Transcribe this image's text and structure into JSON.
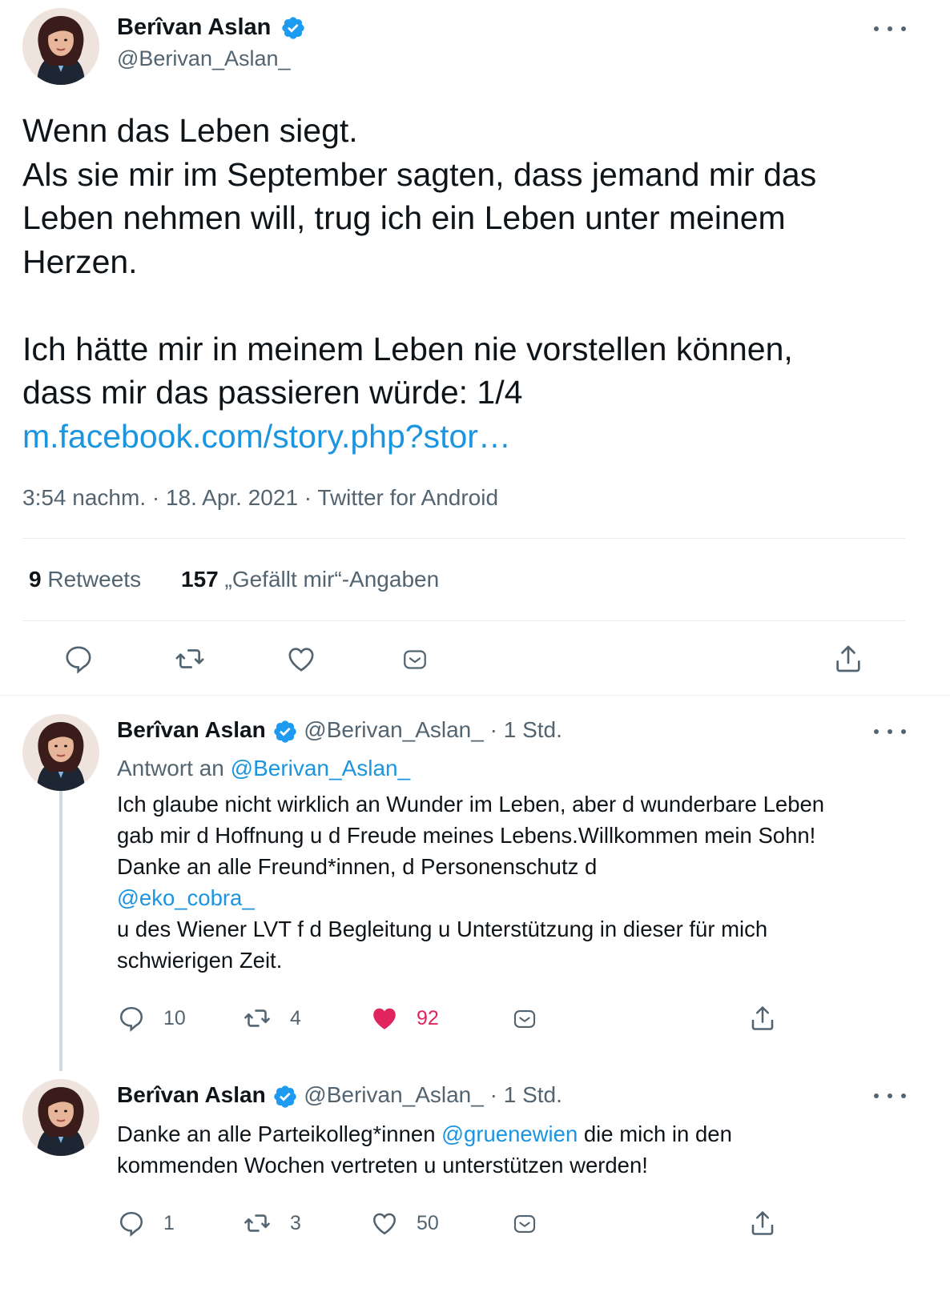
{
  "main_tweet": {
    "author_name": "Berîvan Aslan",
    "author_handle": "@Berivan_Aslan_",
    "text_lines": [
      "Wenn das Leben siegt.",
      "Als sie mir im September sagten, dass jemand mir das",
      "Leben nehmen will, trug ich ein Leben unter meinem",
      "Herzen.",
      "",
      "Ich hätte mir in meinem Leben nie vorstellen können,",
      "dass mir das passieren würde: 1/4"
    ],
    "link": "m.facebook.com/story.php?stor…",
    "meta": "3:54 nachm. · 18. Apr. 2021 · Twitter for Android",
    "retweets_count": "9",
    "retweets_label": "Retweets",
    "likes_count": "157",
    "likes_label": "„Gefällt mir“-Angaben"
  },
  "replies": [
    {
      "author_name": "Berîvan Aslan",
      "author_handle": "@Berivan_Aslan_",
      "time": "· 1 Std.",
      "reply_to_label": "Antwort an",
      "reply_to_handle": "@Berivan_Aslan_",
      "text_lines": [
        "Ich glaube nicht wirklich an Wunder im Leben, aber d wunderbare Leben",
        "gab mir d Hoffnung u d Freude meines Lebens.Willkommen mein Sohn!",
        "Danke an alle Freund*innen, d Personenschutz d"
      ],
      "mention": "@eko_cobra_",
      "text_after_lines": [
        "u des Wiener LVT f d Begleitung u Unterstützung in dieser für mich",
        "schwierigen Zeit."
      ],
      "reply_count": "10",
      "retweet_count": "4",
      "like_count": "92",
      "liked": true
    },
    {
      "author_name": "Berîvan Aslan",
      "author_handle": "@Berivan_Aslan_",
      "time": "· 1 Std.",
      "text_before": "Danke an alle Parteikolleg*innen ",
      "mention": "@gruenewien",
      "text_after": " die mich in den",
      "text_line2": "kommenden Wochen vertreten u unterstützen werden!",
      "reply_count": "1",
      "retweet_count": "3",
      "like_count": "50",
      "liked": false
    }
  ],
  "colors": {
    "link": "#1b95e0",
    "verified": "#1d9bf0",
    "liked": "#e0245e",
    "secondary_text": "#536471"
  },
  "icons": [
    "verified-badge-icon",
    "more-icon",
    "reply-icon",
    "retweet-icon",
    "like-icon",
    "share-via-dm-icon",
    "share-icon"
  ]
}
